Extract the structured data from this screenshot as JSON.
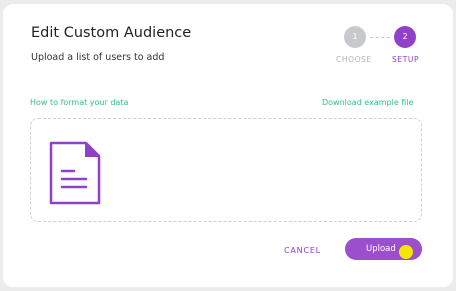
{
  "dialog": {
    "title": "Edit Custom Audience",
    "subtitle": "Upload a list of users to add"
  },
  "stepper": {
    "steps": [
      {
        "number": "1",
        "label": "CHOOSE",
        "state": "inactive"
      },
      {
        "number": "2",
        "label": "SETUP",
        "state": "active"
      }
    ],
    "active_color": "#9141c8",
    "inactive_color": "#c7c9cc"
  },
  "links": {
    "format": "How to format your data",
    "download": "Download example file",
    "color": "#2fbf8e"
  },
  "dropzone": {
    "icon": "document-icon"
  },
  "actions": {
    "cancel_label": "CANCEL",
    "upload_label": "Upload"
  },
  "colors": {
    "accent": "#9141c8",
    "cursor_highlight": "#f5e600"
  }
}
